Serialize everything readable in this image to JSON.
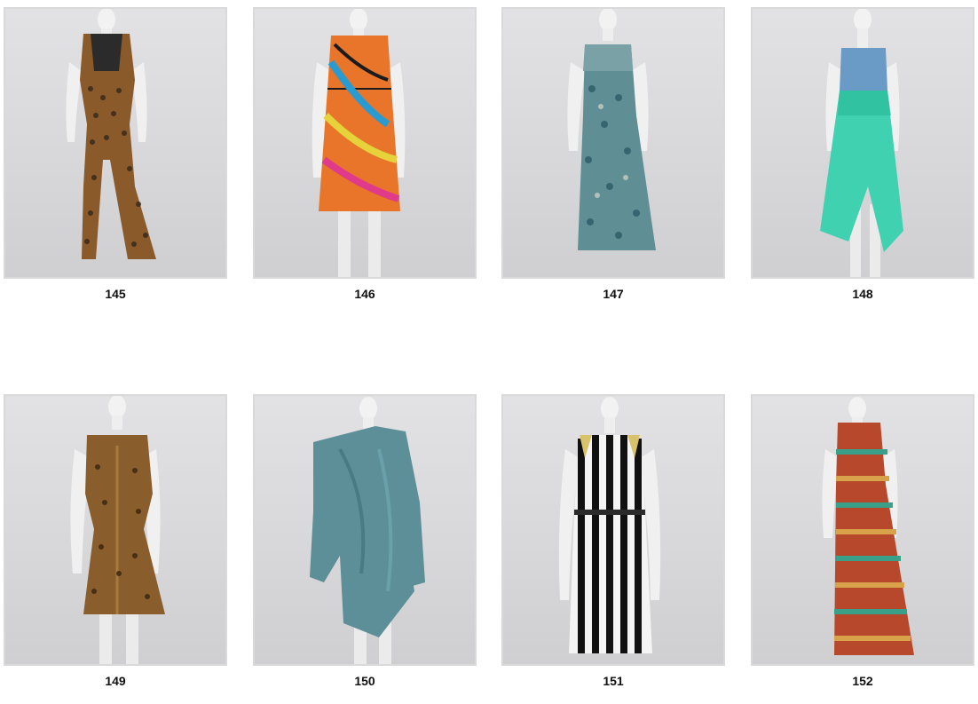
{
  "gallery": {
    "items": [
      {
        "label": "145",
        "garment": "leopard-print-jumpsuit",
        "colors": {
          "main": "#8a5a2b",
          "accent": "#3a2a1a",
          "top": "#2b2b2b"
        }
      },
      {
        "label": "146",
        "garment": "zebra-multicolor-shift-dress",
        "colors": {
          "main": "#e8752a",
          "accent": "#2a9bd1",
          "top": "#1b1b1b"
        }
      },
      {
        "label": "147",
        "garment": "teal-animal-print-maxi-dress",
        "colors": {
          "main": "#5f8e95",
          "accent": "#2d5c66",
          "top": "#7aa1a6"
        }
      },
      {
        "label": "148",
        "garment": "denim-bustier-mint-hi-lo-dress",
        "colors": {
          "main": "#3fd1b0",
          "accent": "#27b898",
          "top": "#6a9bc6"
        }
      },
      {
        "label": "149",
        "garment": "leopard-zip-front-dress",
        "colors": {
          "main": "#8a5d2c",
          "accent": "#3b2712",
          "top": "#a97a3e"
        }
      },
      {
        "label": "150",
        "garment": "teal-one-shoulder-drape-dress",
        "colors": {
          "main": "#5d8f99",
          "accent": "#4a7a84",
          "top": "#6aa0aa"
        }
      },
      {
        "label": "151",
        "garment": "black-white-stripe-halter-dress",
        "colors": {
          "main": "#111111",
          "accent": "#f4f4f4",
          "top": "#d9c36a"
        }
      },
      {
        "label": "152",
        "garment": "tribal-print-maxi-dress",
        "colors": {
          "main": "#b8482c",
          "accent": "#3aa08a",
          "top": "#d7a24a"
        }
      }
    ]
  }
}
